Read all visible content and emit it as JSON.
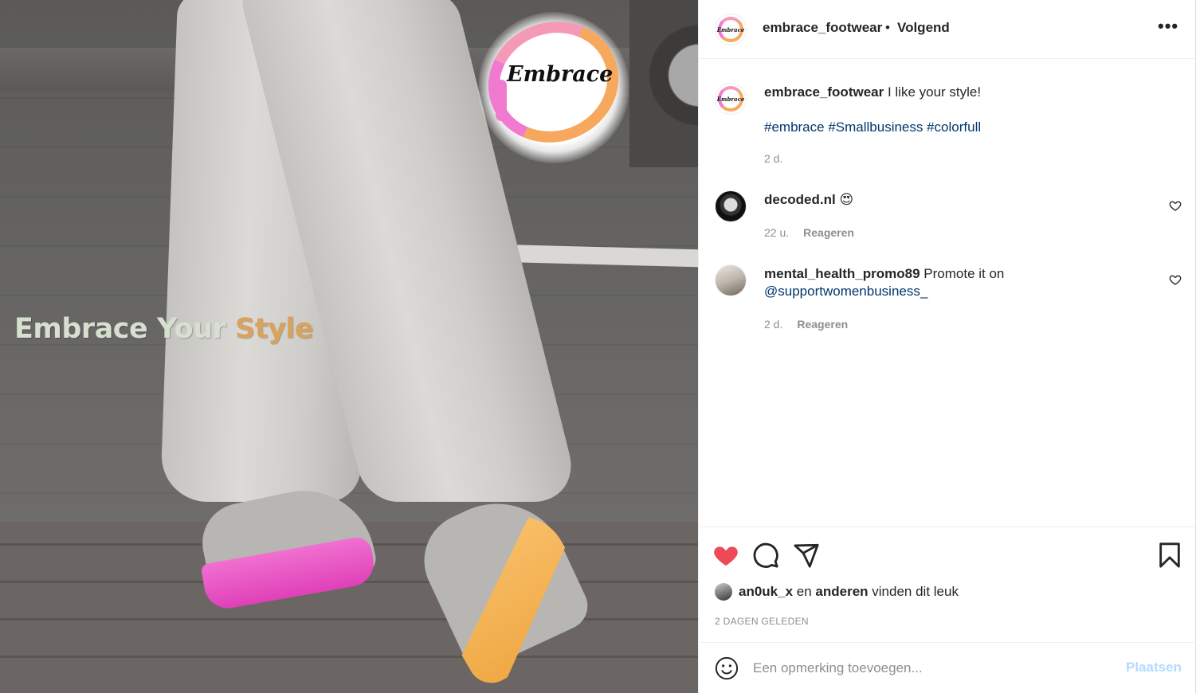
{
  "photo": {
    "logo_text": "Embrace",
    "slogan_part1": "Embrace Your ",
    "slogan_part2": "Style"
  },
  "header": {
    "username": "embrace_footwear",
    "separator": "•",
    "follow_status": "Volgend",
    "more_icon": "more-horizontal-icon"
  },
  "caption": {
    "username": "embrace_footwear",
    "text": " I like your style!",
    "hashtags": "#embrace #Smallbusiness #colorfull",
    "time": "2 d."
  },
  "comments": [
    {
      "username": "decoded.nl",
      "text": " 😍",
      "time": "22 u.",
      "reply_label": "Reageren"
    },
    {
      "username": "mental_health_promo89",
      "text": " Promote it on ",
      "mention": "@supportwomenbusiness_",
      "time": "2 d.",
      "reply_label": "Reageren"
    }
  ],
  "actions": {
    "like_color": "#ed4956",
    "liked_by_user": "an0uk_x",
    "liked_connector": " en ",
    "liked_others": "anderen",
    "liked_suffix": " vinden dit leuk",
    "date": "2 DAGEN GELEDEN"
  },
  "add_comment": {
    "placeholder": "Een opmerking toevoegen...",
    "post_label": "Plaatsen"
  },
  "colors": {
    "link": "#00376b",
    "muted": "#8e8e8e",
    "post_disabled": "#b3dbff"
  }
}
